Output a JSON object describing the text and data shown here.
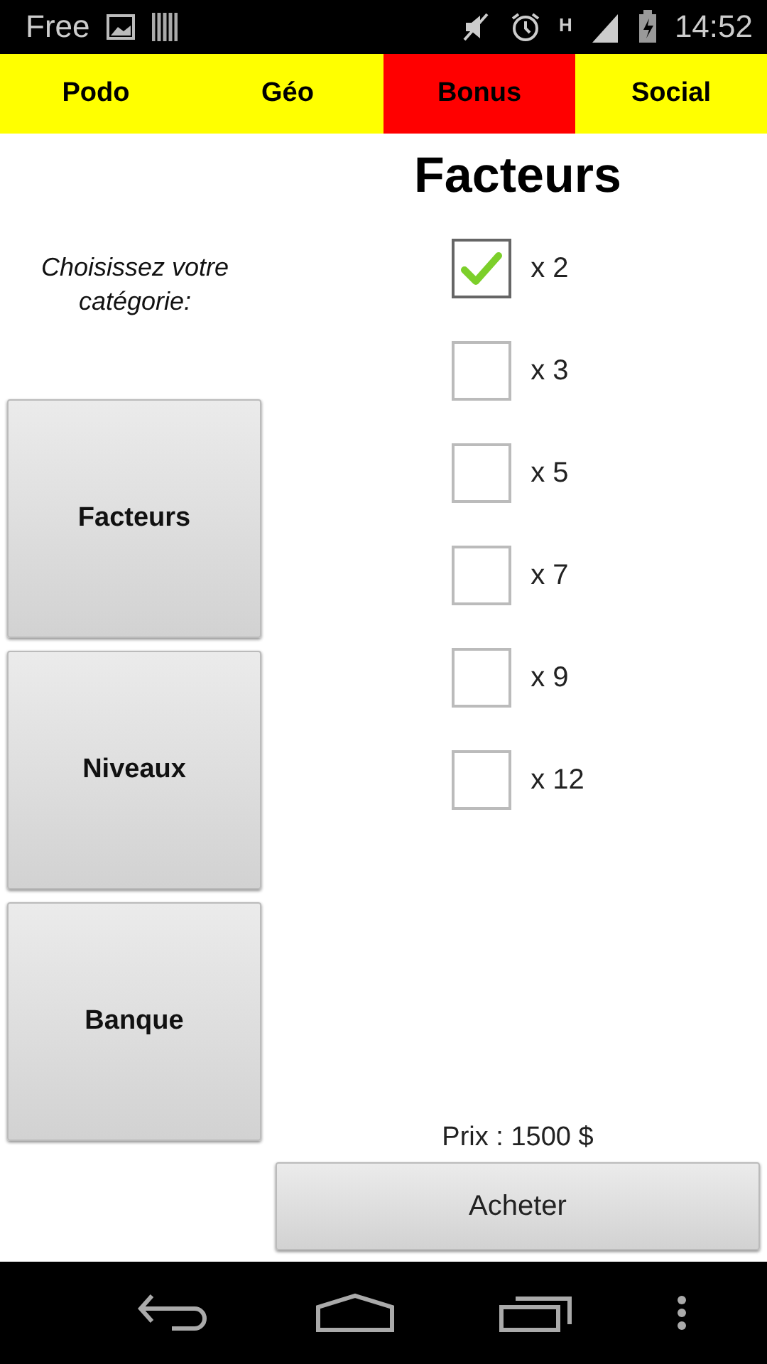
{
  "status_bar": {
    "carrier": "Free",
    "network": "H",
    "time": "14:52"
  },
  "tabs": [
    {
      "label": "Podo",
      "selected": false
    },
    {
      "label": "Géo",
      "selected": false
    },
    {
      "label": "Bonus",
      "selected": true
    },
    {
      "label": "Social",
      "selected": false
    }
  ],
  "sidebar": {
    "prompt": "Choisissez votre catégorie:",
    "buttons": [
      "Facteurs",
      "Niveaux",
      "Banque"
    ]
  },
  "panel": {
    "title": "Facteurs",
    "options": [
      {
        "label": "x 2",
        "checked": true
      },
      {
        "label": "x 3",
        "checked": false
      },
      {
        "label": "x 5",
        "checked": false
      },
      {
        "label": "x 7",
        "checked": false
      },
      {
        "label": "x 9",
        "checked": false
      },
      {
        "label": "x 12",
        "checked": false
      }
    ],
    "price": "Prix : 1500 $",
    "buy_button": "Acheter"
  }
}
